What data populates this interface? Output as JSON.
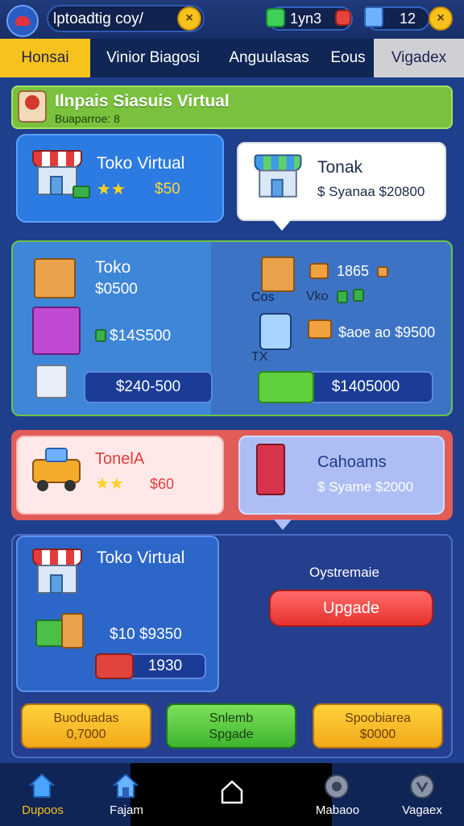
{
  "topbar": {
    "search_value": "lptoadtig coy/",
    "search_close": "×",
    "counter1": "1yn3",
    "counter2": "12",
    "close": "×"
  },
  "tabs": [
    "Honsai",
    "Vinior Biagosi",
    "Anguulasas",
    "Eous",
    "Vigadex"
  ],
  "banner": {
    "title": "Ilnpais Siasuis Virtual",
    "subtitle": "Buaparroe: 8"
  },
  "row1": {
    "left": {
      "title": "Toko Virtual",
      "price": "$50",
      "stars": "★★"
    },
    "right": {
      "title": "Tonak",
      "price": "$ Syanaa $20800"
    }
  },
  "panel2": {
    "title": "Toko",
    "price1": "$0500",
    "price2": "$14S500",
    "button": "$240-500",
    "right_num": "1865",
    "right_label1": "Vko",
    "right_label2": "TX",
    "right_price": "$aoe ao $9500",
    "right_button": "$1405000",
    "tag": "Cos"
  },
  "row3": {
    "left": {
      "title": "TonelA",
      "price": "$60"
    },
    "right": {
      "title": "Cahoams",
      "price": "$ Syame $2000"
    }
  },
  "panel3": {
    "title": "Toko Virtual",
    "price": "$10 $9350",
    "bar_value": "1930",
    "label": "Oystremaie",
    "upgrade": "Upgade"
  },
  "bottom_buttons": [
    {
      "line1": "Buoduadas",
      "line2": "0,7000"
    },
    {
      "line1": "Snlemb",
      "line2": "Spgade"
    },
    {
      "line1": "Spoobiarea",
      "line2": "$0000"
    }
  ],
  "nav": [
    "Dupoos",
    "Fajam",
    "Mabaoo",
    "Vagaex"
  ],
  "colors": {
    "accent_yellow": "#f7c21e",
    "tab_bar": "#102655",
    "background": "#1d3f8c"
  }
}
